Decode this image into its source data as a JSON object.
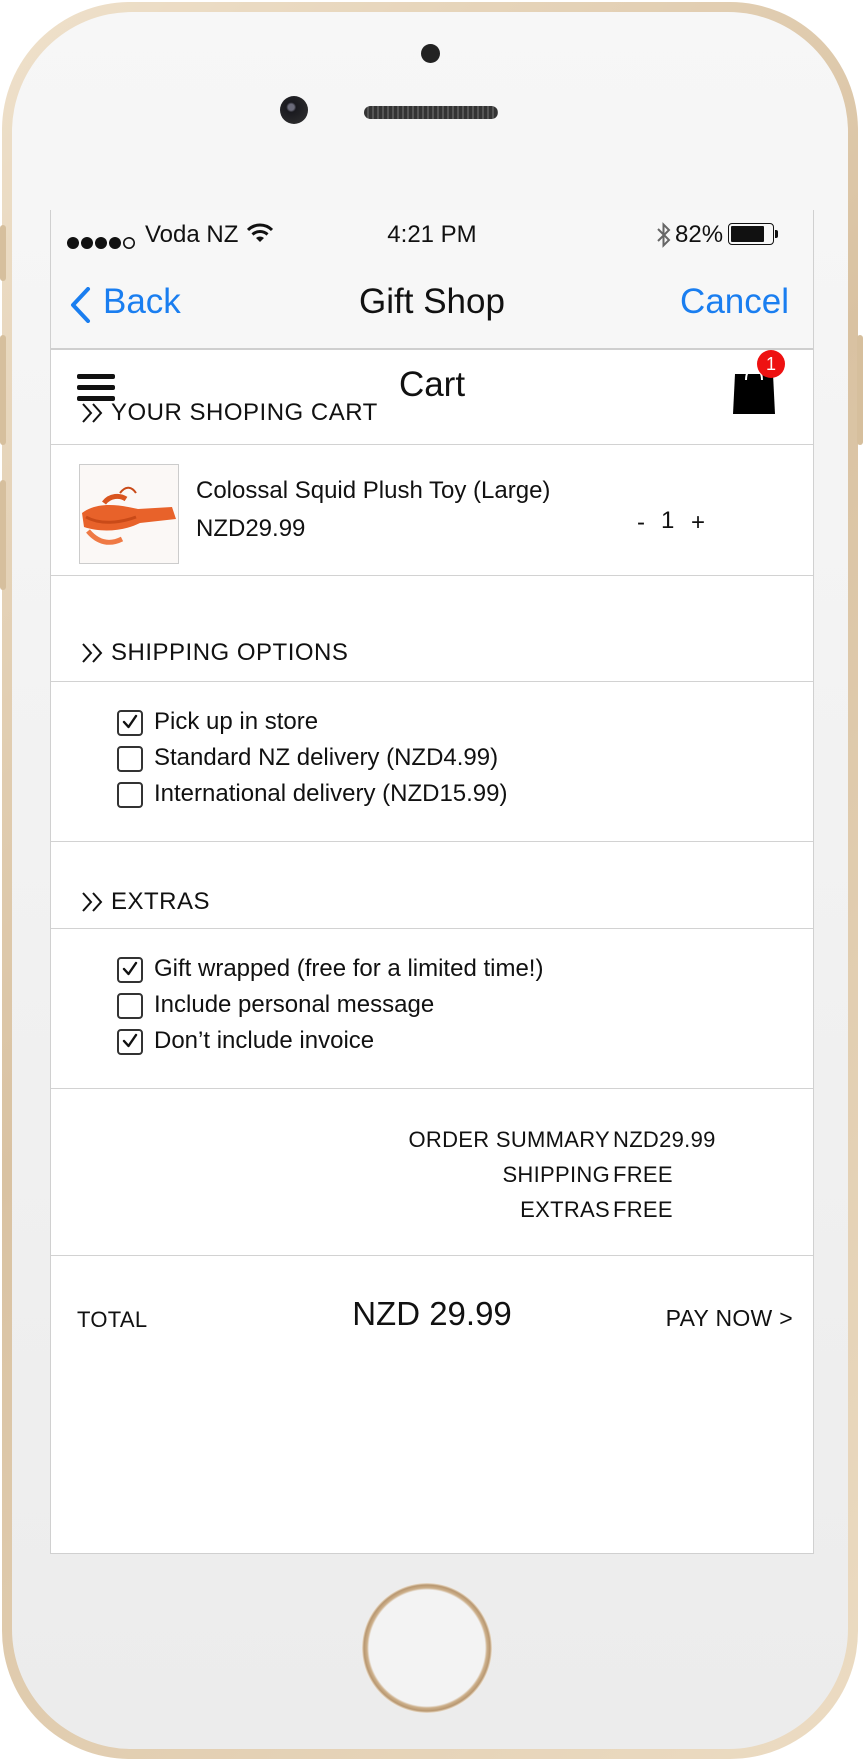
{
  "status_bar": {
    "carrier": "Voda NZ",
    "time": "4:21 PM",
    "battery": "82%",
    "battery_level": 0.82
  },
  "nav_bar": {
    "back_label": "Back",
    "title": "Gift Shop",
    "cancel_label": "Cancel"
  },
  "header": {
    "title": "Cart",
    "cart_badge": "1"
  },
  "cart_section": {
    "title": "YOUR SHOPING CART",
    "item": {
      "name": "Colossal Squid Plush Toy (Large)",
      "price": "NZD29.99",
      "quantity": "1",
      "minus": "-",
      "plus": "+"
    }
  },
  "shipping_section": {
    "title": "SHIPPING OPTIONS",
    "options": [
      {
        "label": "Pick up in store",
        "checked": true
      },
      {
        "label": "Standard NZ delivery (NZD4.99)",
        "checked": false
      },
      {
        "label": "International delivery (NZD15.99)",
        "checked": false
      }
    ]
  },
  "extras_section": {
    "title": "EXTRAS",
    "options": [
      {
        "label": "Gift wrapped (free for a limited time!)",
        "checked": true
      },
      {
        "label": "Include personal message",
        "checked": false
      },
      {
        "label": "Don’t include invoice",
        "checked": true
      }
    ]
  },
  "summary": {
    "rows": [
      {
        "label": "ORDER SUMMARY",
        "value": "NZD29.99"
      },
      {
        "label": "SHIPPING",
        "value": "FREE"
      },
      {
        "label": "EXTRAS",
        "value": "FREE"
      }
    ]
  },
  "footer": {
    "total_label": "TOTAL",
    "total_value": "NZD 29.99",
    "pay_label": "PAY NOW >"
  },
  "colors": {
    "ios_blue": "#1a7ef0",
    "badge_red": "#ee1111",
    "frame_gold": "#e3cfb1"
  }
}
